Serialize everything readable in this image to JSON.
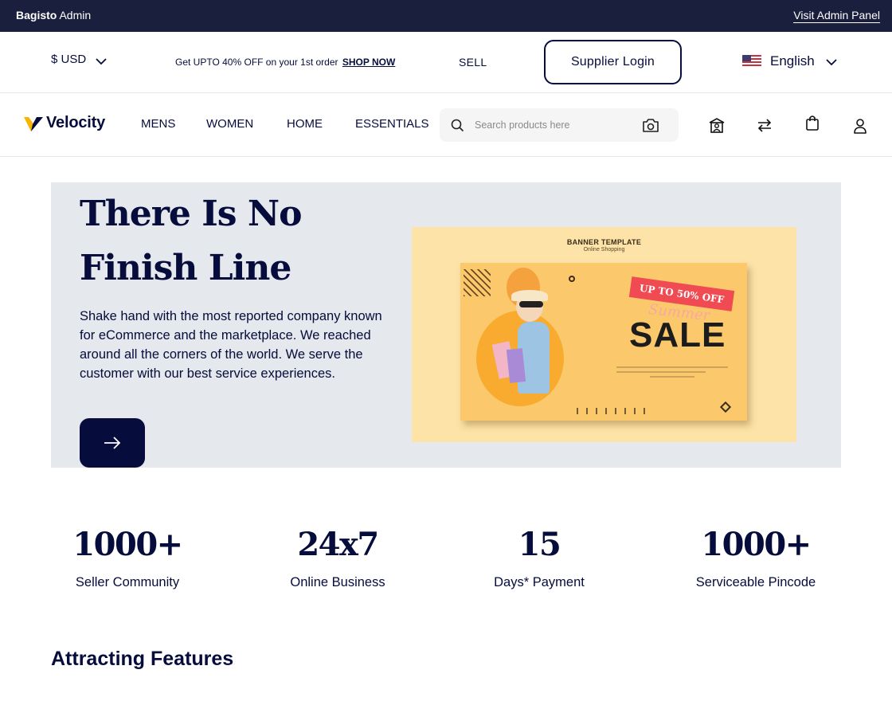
{
  "admin_bar": {
    "brand_bold": "Bagisto",
    "brand_rest": " Admin",
    "link": "Visit Admin Panel"
  },
  "promo_bar": {
    "currency": "$ USD",
    "offer_text": "Get UPTO 40% OFF on your 1st order",
    "offer_link": "SHOP NOW",
    "sell": "SELL",
    "supplier_login": "Supplier Login",
    "language": "English"
  },
  "nav": {
    "logo": "Velocity",
    "menu": [
      "MENS",
      "WOMEN",
      "HOME",
      "ESSENTIALS"
    ],
    "search_placeholder": "Search products here",
    "icons": [
      "compare-store-icon",
      "swap-arrows-icon",
      "shopping-bag-icon",
      "user-icon"
    ]
  },
  "hero": {
    "title": "There Is No Finish Line",
    "description": "Shake hand with the most reported company known for eCommerce and the marketplace. We reached around all the corners of the world. We serve the customer with our best service experiences.",
    "banner": {
      "heading": "BANNER TEMPLATE",
      "subheading": "Online Shopping",
      "ribbon": "UP TO 50% OFF",
      "script_word": "Summer",
      "sale_word": "SALE"
    }
  },
  "stats": [
    {
      "value": "1000+",
      "label": "Seller Community"
    },
    {
      "value": "24x7",
      "label": "Online Business"
    },
    {
      "value": "15",
      "label": "Days* Payment"
    },
    {
      "value": "1000+",
      "label": "Serviceable Pincode"
    }
  ],
  "section": {
    "title": "Attracting Features"
  },
  "colors": {
    "admin_bar": "#1a1f3d",
    "navy": "#060c3b",
    "hero_bg": "#e5e8ec",
    "banner_bg": "#fde3a7",
    "ribbon": "#f04a52"
  }
}
